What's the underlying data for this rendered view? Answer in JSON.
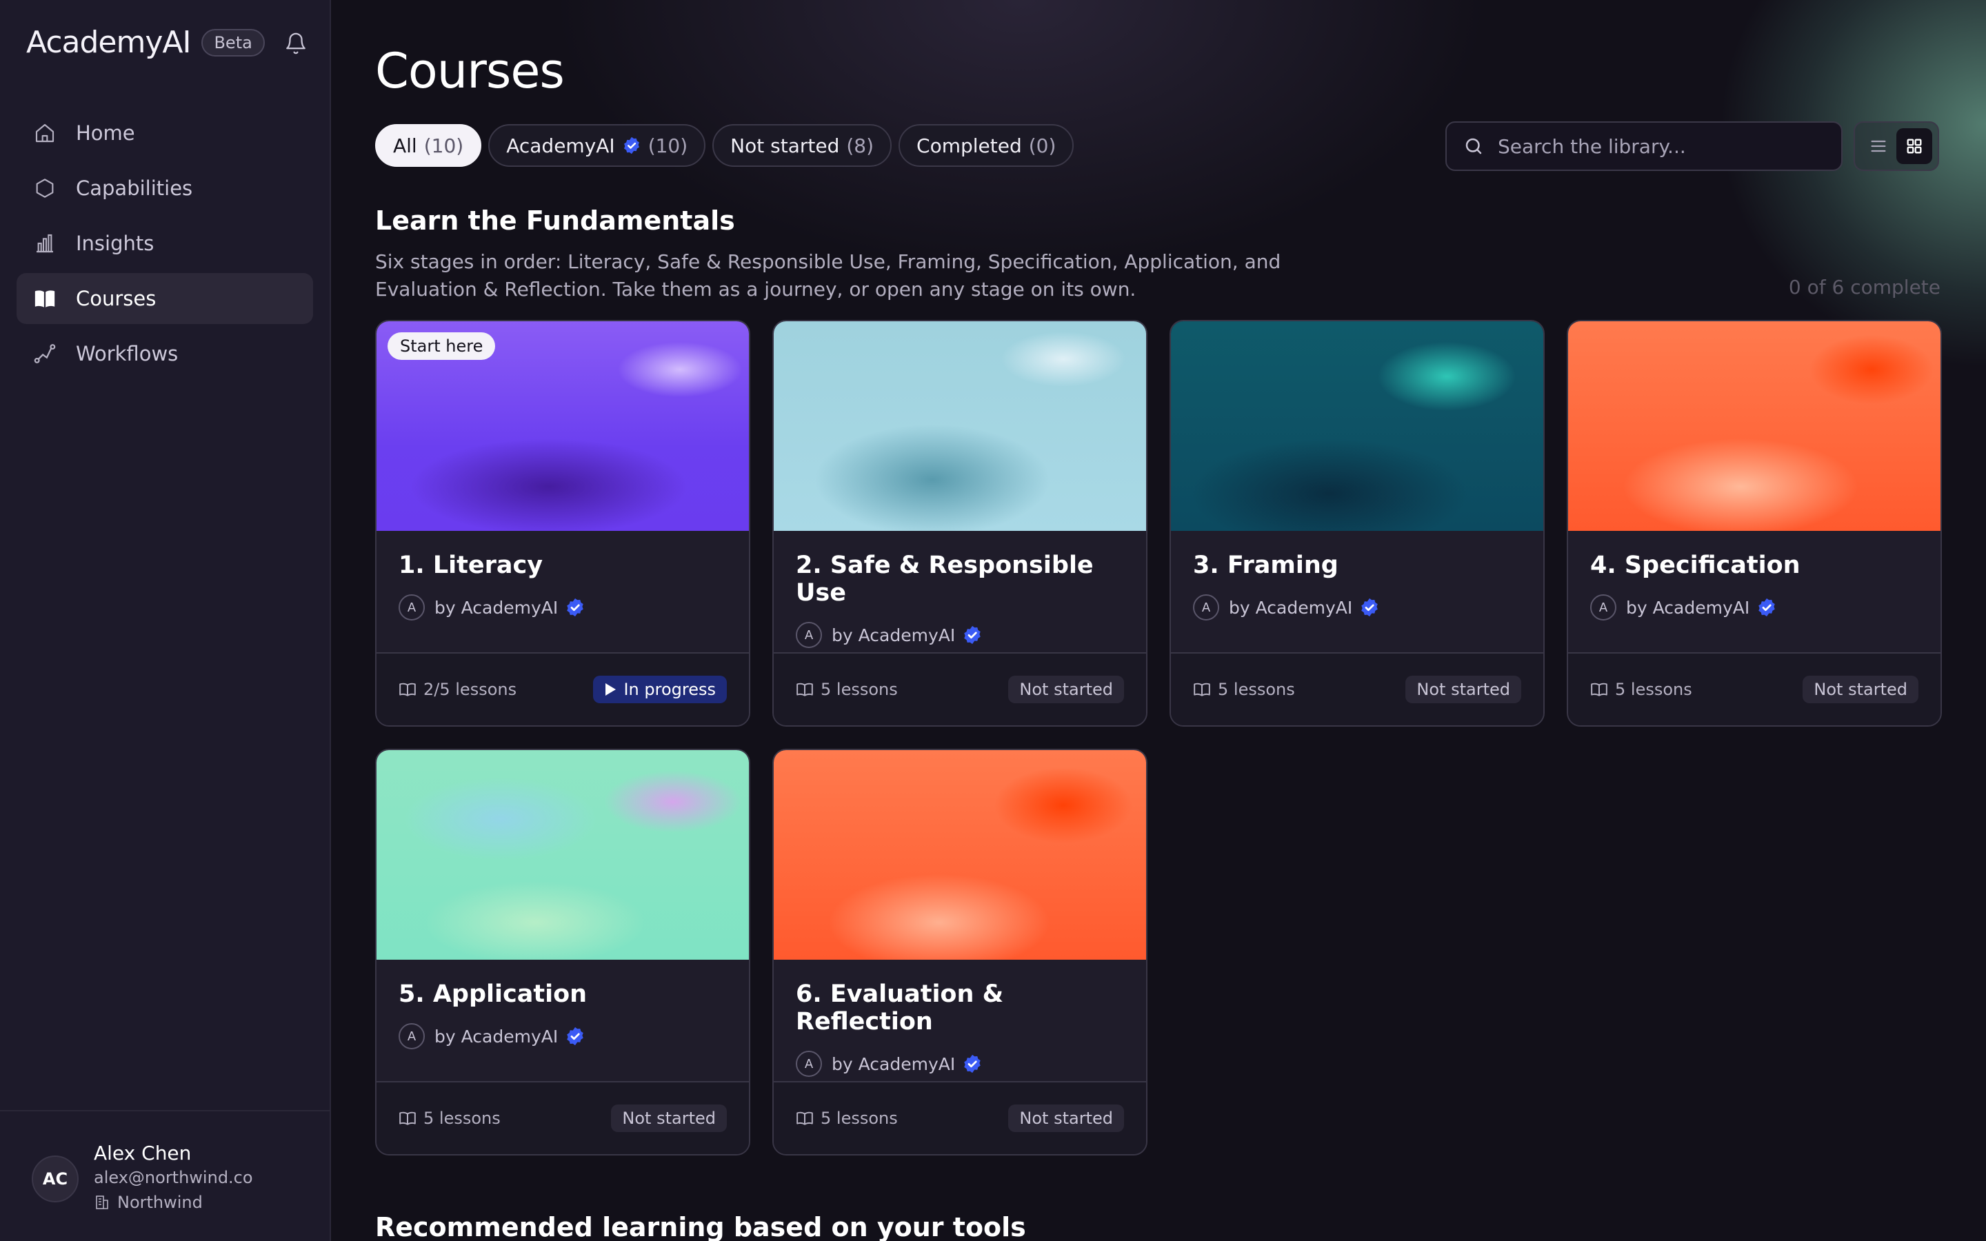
{
  "app": {
    "name": "AcademyAI",
    "badge": "Beta"
  },
  "nav": {
    "items": [
      {
        "label": "Home",
        "icon": "home-icon"
      },
      {
        "label": "Capabilities",
        "icon": "hexagon-icon"
      },
      {
        "label": "Insights",
        "icon": "bar-chart-icon"
      },
      {
        "label": "Courses",
        "icon": "book-icon",
        "active": true
      },
      {
        "label": "Workflows",
        "icon": "workflow-icon"
      }
    ]
  },
  "user": {
    "initials": "AC",
    "name": "Alex Chen",
    "email": "alex@northwind.co",
    "org": "Northwind"
  },
  "page": {
    "title": "Courses"
  },
  "filters": [
    {
      "label": "All",
      "count": "(10)",
      "active": true
    },
    {
      "label": "AcademyAI",
      "count": "(10)",
      "verified": true
    },
    {
      "label": "Not started",
      "count": "(8)"
    },
    {
      "label": "Completed",
      "count": "(0)"
    }
  ],
  "search": {
    "placeholder": "Search the library..."
  },
  "section": {
    "title": "Learn the Fundamentals",
    "description": "Six stages in order: Literacy, Safe & Responsible Use, Framing, Specification, Application, and Evaluation & Reflection. Take them as a journey, or open any stage on its own.",
    "progress": "0 of 6 complete"
  },
  "courses": [
    {
      "title": "1. Literacy",
      "author": "by AcademyAI",
      "author_initial": "A",
      "lessons": "2/5 lessons",
      "status": "In progress",
      "badge": "Start here"
    },
    {
      "title": "2. Safe & Responsible Use",
      "author": "by AcademyAI",
      "author_initial": "A",
      "lessons": "5 lessons",
      "status": "Not started"
    },
    {
      "title": "3. Framing",
      "author": "by AcademyAI",
      "author_initial": "A",
      "lessons": "5 lessons",
      "status": "Not started"
    },
    {
      "title": "4. Specification",
      "author": "by AcademyAI",
      "author_initial": "A",
      "lessons": "5 lessons",
      "status": "Not started"
    },
    {
      "title": "5. Application",
      "author": "by AcademyAI",
      "author_initial": "A",
      "lessons": "5 lessons",
      "status": "Not started"
    },
    {
      "title": "6. Evaluation & Reflection",
      "author": "by AcademyAI",
      "author_initial": "A",
      "lessons": "5 lessons",
      "status": "Not started"
    }
  ],
  "next_section": {
    "title": "Recommended learning based on your tools"
  },
  "colors": {
    "accent": "#3b5bf5",
    "progress_badge": "#1e2a78",
    "background": "#121019",
    "sidebar": "#1d1a2a"
  }
}
